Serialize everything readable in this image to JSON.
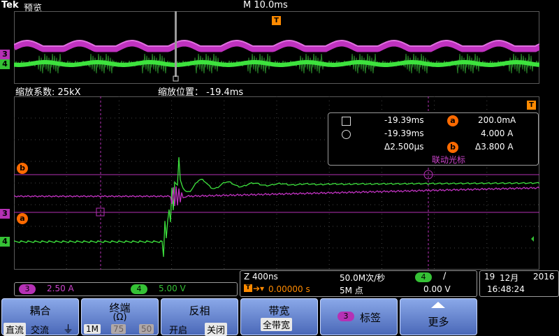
{
  "header": {
    "brand": "Tek",
    "mode": "预览",
    "timebase": "M 10.0ms"
  },
  "zoom": {
    "factor_label": "缩放系数: 25kX",
    "position_label": "缩放位置：  -19.4ms"
  },
  "markers": {
    "trigger": "T",
    "cursor_a": "a",
    "cursor_b": "b",
    "ch3": "3",
    "ch4": "4"
  },
  "readout": {
    "row1_time": "-19.39ms",
    "row1_value": "200.0mA",
    "row2_time": "-19.39ms",
    "row2_value": "4.000 A",
    "row3_time": "Δ2.500µs",
    "row3_value": "Δ3.800 A",
    "linked": "联动光标"
  },
  "vertical": {
    "ch3_num": "3",
    "ch3_scale": "2.50 A",
    "ch4_num": "4",
    "ch4_scale": "5.00 V"
  },
  "horizontal": {
    "zoom_scale": "Z 400ns",
    "sample_rate": "50.0M次/秒",
    "trig_source": "4",
    "trig_slope": "∕",
    "trig_pos": "0.00000 s",
    "record_length": "5M 点",
    "trig_level": "0.00 V"
  },
  "datetime": {
    "date_day": "19",
    "date_month": "12月",
    "date_year": "2016",
    "time": "16:48:24"
  },
  "softkeys": {
    "coupling": {
      "title": "耦合",
      "opt1": "直流",
      "opt2": "交流",
      "opt3": "⏚"
    },
    "termination": {
      "title": "终端",
      "sub": "(Ω)",
      "opt1": "1M",
      "opt2": "75",
      "opt3": "50"
    },
    "invert": {
      "title": "反相",
      "opt1": "开启",
      "opt2": "关闭"
    },
    "bandwidth": {
      "title": "带宽",
      "value": "全带宽"
    },
    "label": {
      "badge": "3",
      "title": "标签"
    },
    "more": {
      "title": "更多"
    }
  },
  "colors": {
    "ch3": "#b531b5",
    "ch4": "#35c135",
    "cursor": "#ff6a00"
  }
}
